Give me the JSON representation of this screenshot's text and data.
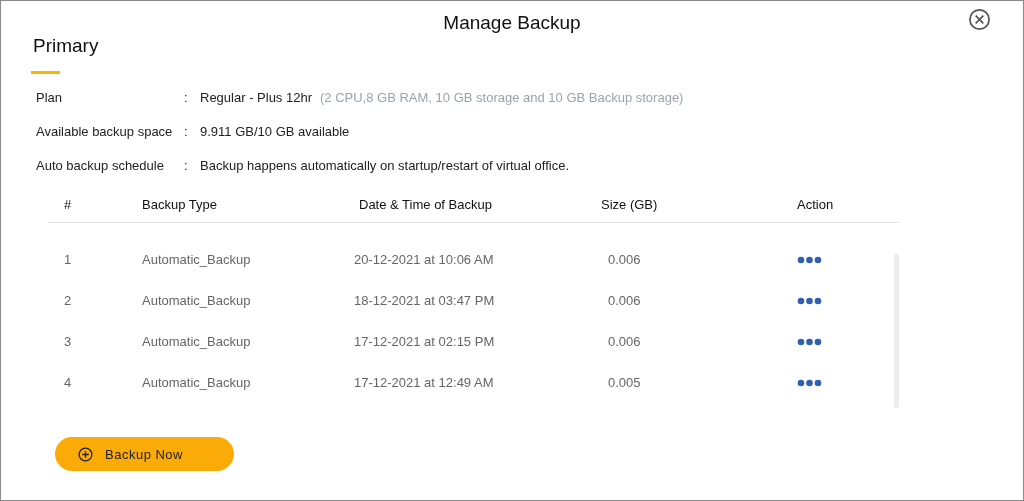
{
  "dialog": {
    "title": "Manage Backup"
  },
  "tabs": [
    {
      "label": "Primary",
      "selected": true
    }
  ],
  "details": [
    {
      "label": "Plan",
      "separator": ":",
      "value": "Regular - Plus 12hr",
      "note": "(2 CPU,8 GB RAM, 10 GB storage and 10 GB Backup storage)"
    },
    {
      "label": "Available backup space",
      "separator": ":",
      "value": "9.911 GB/10 GB available"
    },
    {
      "label": "Auto backup schedule",
      "separator": ":",
      "value": "Backup happens automatically on startup/restart of virtual office."
    }
  ],
  "table": {
    "columns": [
      "#",
      "Backup Type",
      "Date & Time of Backup",
      "Size (GB)",
      "Action"
    ],
    "rows": [
      {
        "number": "1",
        "type": "Automatic_Backup",
        "datetime": "20-12-2021 at 10:06 AM",
        "size": "0.006"
      },
      {
        "number": "2",
        "type": "Automatic_Backup",
        "datetime": "18-12-2021 at 03:47 PM",
        "size": "0.006"
      },
      {
        "number": "3",
        "type": "Automatic_Backup",
        "datetime": "17-12-2021 at 02:15 PM",
        "size": "0.006"
      },
      {
        "number": "4",
        "type": "Automatic_Backup",
        "datetime": "17-12-2021 at 12:49 AM",
        "size": "0.005"
      }
    ]
  },
  "primary_button": {
    "label": "Backup Now"
  }
}
